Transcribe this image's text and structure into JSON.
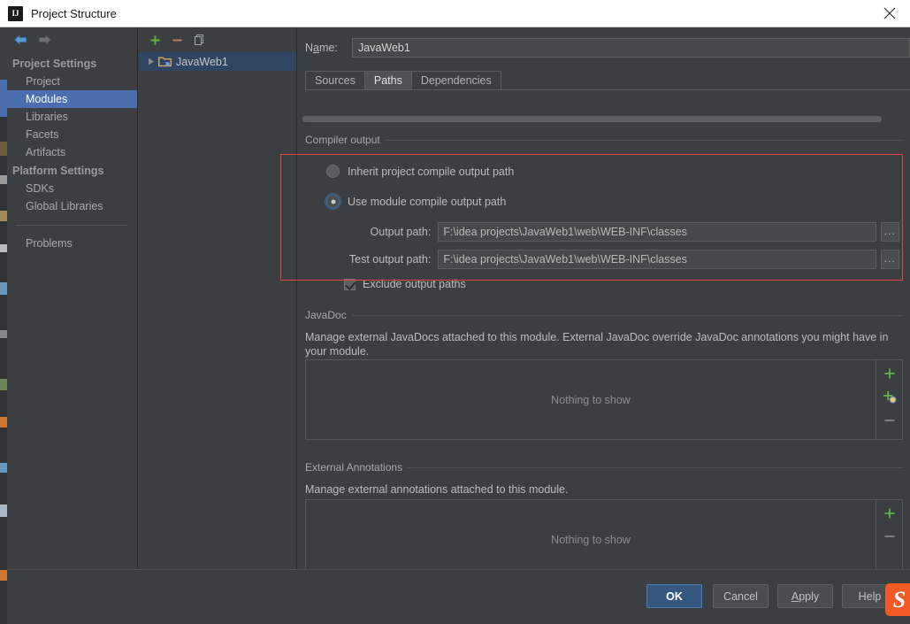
{
  "window": {
    "title": "Project Structure",
    "logo_icon": "intellij-idea-logo",
    "close_icon": "close-icon"
  },
  "sidebar": {
    "back_icon": "arrow-left-icon",
    "forward_icon": "arrow-right-icon",
    "groups": [
      {
        "label": "Project Settings",
        "items": [
          {
            "label": "Project",
            "selected": false
          },
          {
            "label": "Modules",
            "selected": true
          },
          {
            "label": "Libraries",
            "selected": false
          },
          {
            "label": "Facets",
            "selected": false
          },
          {
            "label": "Artifacts",
            "selected": false
          }
        ]
      },
      {
        "label": "Platform Settings",
        "items": [
          {
            "label": "SDKs",
            "selected": false
          },
          {
            "label": "Global Libraries",
            "selected": false
          }
        ]
      }
    ],
    "problems_label": "Problems"
  },
  "tree": {
    "toolbar": {
      "add_icon": "plus-icon",
      "remove_icon": "minus-icon",
      "copy_icon": "copy-icon"
    },
    "nodes": [
      {
        "label": "JavaWeb1",
        "expand_icon": "triangle-right-icon",
        "node_icon": "module-folder-icon",
        "selected": true
      }
    ]
  },
  "main": {
    "name_label": "Name:",
    "name_mnemonic": "a",
    "name_value": "JavaWeb1",
    "tabs": [
      {
        "label": "Sources",
        "active": false
      },
      {
        "label": "Paths",
        "active": true
      },
      {
        "label": "Dependencies",
        "active": false
      }
    ],
    "compiler_output": {
      "group_label": "Compiler output",
      "inherit_radio_label": "Inherit project compile output path",
      "inherit_selected": false,
      "module_radio_label": "Use module compile output path",
      "module_selected": true,
      "output_path_label": "Output path:",
      "output_path_value": "F:\\idea projects\\JavaWeb1\\web\\WEB-INF\\classes",
      "test_output_path_label": "Test output path:",
      "test_output_path_value": "F:\\idea projects\\JavaWeb1\\web\\WEB-INF\\classes",
      "browse_label": "...",
      "exclude_checkbox_label": "Exclude output paths",
      "exclude_checked": true,
      "highlight_color": "#e64343"
    },
    "javadoc": {
      "group_label": "JavaDoc",
      "description": "Manage external JavaDocs attached to this module. External JavaDoc override JavaDoc annotations you might have in your module.",
      "empty_text": "Nothing to show",
      "add_icon": "plus-icon",
      "add_url_icon": "plus-globe-icon",
      "remove_icon": "minus-icon"
    },
    "external_annotations": {
      "group_label": "External Annotations",
      "description": "Manage external annotations attached to this module.",
      "empty_text": "Nothing to show",
      "add_icon": "plus-icon",
      "remove_icon": "minus-icon"
    }
  },
  "footer": {
    "ok_label": "OK",
    "cancel_label": "Cancel",
    "apply_label": "Apply",
    "apply_mnemonic": "A",
    "help_label": "Help",
    "sogou_icon": "sogou-input-logo",
    "sogou_letter": "S"
  },
  "colors": {
    "accent": "#4b6eaf",
    "primary_button": "#365880",
    "highlight": "#e64343",
    "add_green": "#62b543",
    "remove_red": "#d0796a",
    "panel_bg": "#3c3f41",
    "titlebar_bg": "#ffffff"
  }
}
